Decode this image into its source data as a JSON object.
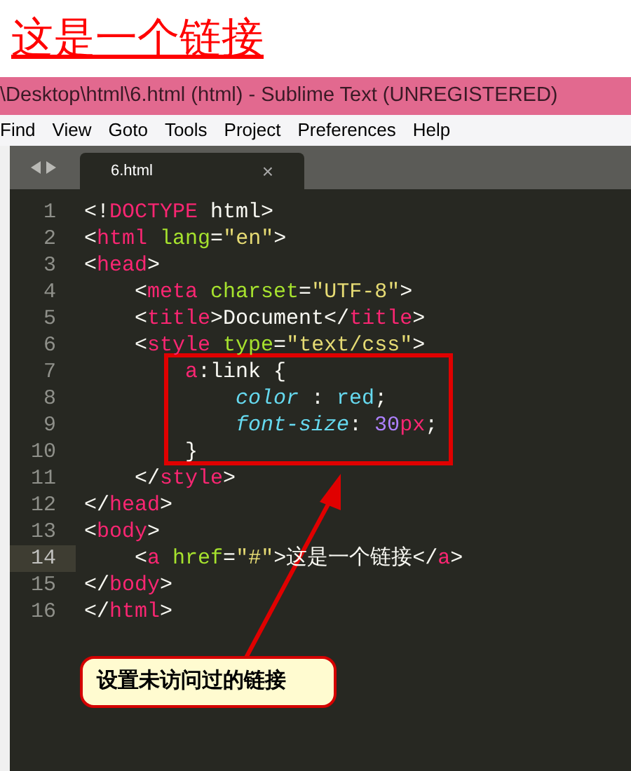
{
  "page_link": "这是一个链接",
  "window": {
    "title": "\\Desktop\\html\\6.html (html) - Sublime Text (UNREGISTERED)"
  },
  "menu": [
    "Find",
    "View",
    "Goto",
    "Tools",
    "Project",
    "Preferences",
    "Help"
  ],
  "tabs": [
    {
      "label": "6.html",
      "selected": true,
      "close": "×"
    }
  ],
  "lines": [
    {
      "number": "1",
      "current": false,
      "tokens": [
        {
          "kind": "punct",
          "text": "<!"
        },
        {
          "kind": "tag",
          "text": "DOCTYPE"
        },
        {
          "kind": "punct",
          "text": " html>"
        }
      ]
    },
    {
      "number": "2",
      "current": false,
      "tokens": [
        {
          "kind": "punct",
          "text": "<"
        },
        {
          "kind": "tag",
          "text": "html"
        },
        {
          "kind": "attr",
          "text": " lang"
        },
        {
          "kind": "punct",
          "text": "="
        },
        {
          "kind": "string",
          "text": "\"en\""
        },
        {
          "kind": "punct",
          "text": ">"
        }
      ]
    },
    {
      "number": "3",
      "current": false,
      "tokens": [
        {
          "kind": "punct",
          "text": "<"
        },
        {
          "kind": "tag",
          "text": "head"
        },
        {
          "kind": "punct",
          "text": ">"
        }
      ]
    },
    {
      "number": "4",
      "current": false,
      "tokens": [
        {
          "kind": "punct",
          "text": "    <"
        },
        {
          "kind": "tag",
          "text": "meta"
        },
        {
          "kind": "attr",
          "text": " charset"
        },
        {
          "kind": "punct",
          "text": "="
        },
        {
          "kind": "string",
          "text": "\"UTF-8\""
        },
        {
          "kind": "punct",
          "text": ">"
        }
      ]
    },
    {
      "number": "5",
      "current": false,
      "tokens": [
        {
          "kind": "punct",
          "text": "    <"
        },
        {
          "kind": "tag",
          "text": "title"
        },
        {
          "kind": "punct",
          "text": ">Document</"
        },
        {
          "kind": "tag",
          "text": "title"
        },
        {
          "kind": "punct",
          "text": ">"
        }
      ]
    },
    {
      "number": "6",
      "current": false,
      "tokens": [
        {
          "kind": "punct",
          "text": "    <"
        },
        {
          "kind": "tag",
          "text": "style"
        },
        {
          "kind": "attr",
          "text": " type"
        },
        {
          "kind": "punct",
          "text": "="
        },
        {
          "kind": "string",
          "text": "\"text/css\""
        },
        {
          "kind": "punct",
          "text": ">"
        }
      ]
    },
    {
      "number": "7",
      "current": false,
      "tokens": [
        {
          "kind": "tag",
          "text": "        a"
        },
        {
          "kind": "punct",
          "text": ":link {"
        }
      ]
    },
    {
      "number": "8",
      "current": false,
      "tokens": [
        {
          "kind": "prop",
          "text": "            color"
        },
        {
          "kind": "punct",
          "text": " : "
        },
        {
          "kind": "value",
          "text": "red"
        },
        {
          "kind": "punct",
          "text": ";"
        }
      ]
    },
    {
      "number": "9",
      "current": false,
      "tokens": [
        {
          "kind": "prop",
          "text": "            font-size"
        },
        {
          "kind": "punct",
          "text": ": "
        },
        {
          "kind": "num",
          "text": "30"
        },
        {
          "kind": "tag",
          "text": "px"
        },
        {
          "kind": "punct",
          "text": ";"
        }
      ]
    },
    {
      "number": "10",
      "current": false,
      "tokens": [
        {
          "kind": "punct",
          "text": "        }"
        }
      ]
    },
    {
      "number": "11",
      "current": false,
      "tokens": [
        {
          "kind": "punct",
          "text": "    </"
        },
        {
          "kind": "tag",
          "text": "style"
        },
        {
          "kind": "punct",
          "text": ">"
        }
      ]
    },
    {
      "number": "12",
      "current": false,
      "tokens": [
        {
          "kind": "punct",
          "text": "</"
        },
        {
          "kind": "tag",
          "text": "head"
        },
        {
          "kind": "punct",
          "text": ">"
        }
      ]
    },
    {
      "number": "13",
      "current": false,
      "tokens": [
        {
          "kind": "punct",
          "text": "<"
        },
        {
          "kind": "tag",
          "text": "body"
        },
        {
          "kind": "punct",
          "text": ">"
        }
      ]
    },
    {
      "number": "14",
      "current": true,
      "tokens": [
        {
          "kind": "punct",
          "text": "    <"
        },
        {
          "kind": "tag",
          "text": "a"
        },
        {
          "kind": "attr",
          "text": " href"
        },
        {
          "kind": "punct",
          "text": "="
        },
        {
          "kind": "string",
          "text": "\"#\""
        },
        {
          "kind": "punct",
          "text": ">这是一个链接</"
        },
        {
          "kind": "tag",
          "text": "a"
        },
        {
          "kind": "punct",
          "text": ">"
        }
      ]
    },
    {
      "number": "15",
      "current": false,
      "tokens": [
        {
          "kind": "punct",
          "text": "</"
        },
        {
          "kind": "tag",
          "text": "body"
        },
        {
          "kind": "punct",
          "text": ">"
        }
      ]
    },
    {
      "number": "16",
      "current": false,
      "tokens": [
        {
          "kind": "punct",
          "text": "</"
        },
        {
          "kind": "tag",
          "text": "html"
        },
        {
          "kind": "punct",
          "text": ">"
        }
      ]
    }
  ],
  "callout": "设置未访问过的链接"
}
